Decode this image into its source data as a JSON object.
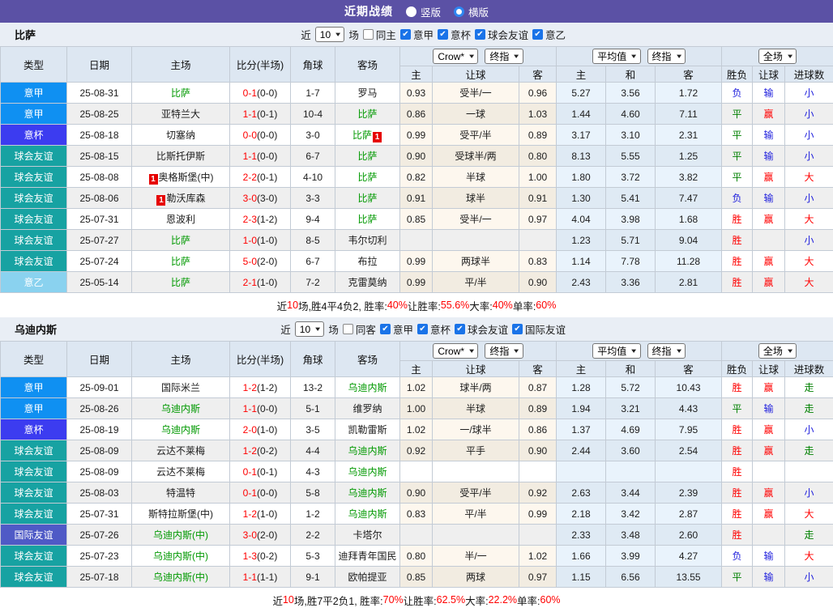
{
  "titlebar": {
    "title": "近期战绩",
    "radio_vertical": "竖版",
    "radio_horizontal": "横版",
    "selected": "横版"
  },
  "colors": {
    "titlebar_bg": "#5b51a5",
    "type_badges": {
      "意甲": "#0f90f2",
      "意杯": "#3c3cf0",
      "球会友谊": "#17a2a2",
      "意乙": "#8ad2ef",
      "国际友谊": "#4f5ac6"
    },
    "result_text": {
      "胜": "#ff0000",
      "平": "#008000",
      "负": "#2020dd",
      "赢": "#ff0000",
      "输": "#2020dd",
      "大": "#ff0000",
      "小": "#2020dd",
      "走": "#008000"
    },
    "team_highlight": "#009900",
    "score": "#ff0000"
  },
  "table_header": {
    "main_cols": [
      "类型",
      "日期",
      "主场",
      "比分(半场)",
      "角球",
      "客场"
    ],
    "odds_selects": [
      "Crow*",
      "终指"
    ],
    "odds_cols": [
      "主",
      "让球",
      "客"
    ],
    "avg_selects": [
      "平均值",
      "终指"
    ],
    "avg_cols": [
      "主",
      "和",
      "客"
    ],
    "result_selects": [
      "全场"
    ],
    "result_cols": [
      "胜负",
      "让球",
      "进球数"
    ]
  },
  "sections": [
    {
      "team": "比萨",
      "filter": {
        "prefix": "近",
        "matches": "10",
        "suffix": "场",
        "same_label": "同主",
        "same_checked": false,
        "leagues": [
          {
            "label": "意甲",
            "checked": true
          },
          {
            "label": "意杯",
            "checked": true
          },
          {
            "label": "球会友谊",
            "checked": true
          },
          {
            "label": "意乙",
            "checked": true
          }
        ]
      },
      "rows": [
        {
          "type": "意甲",
          "date": "25-08-31",
          "home": "比萨",
          "home_team": true,
          "home_card": "",
          "score": "0-1",
          "half": "0-0",
          "corner": "1-7",
          "away": "罗马",
          "away_team": false,
          "away_card": "",
          "odds": [
            "0.93",
            "受半/一",
            "0.96"
          ],
          "avg": [
            "5.27",
            "3.56",
            "1.72"
          ],
          "result": [
            "负",
            "输",
            "小"
          ]
        },
        {
          "type": "意甲",
          "date": "25-08-25",
          "home": "亚特兰大",
          "home_team": false,
          "home_card": "",
          "score": "1-1",
          "half": "0-1",
          "corner": "10-4",
          "away": "比萨",
          "away_team": true,
          "away_card": "",
          "odds": [
            "0.86",
            "一球",
            "1.03"
          ],
          "avg": [
            "1.44",
            "4.60",
            "7.11"
          ],
          "result": [
            "平",
            "赢",
            "小"
          ]
        },
        {
          "type": "意杯",
          "date": "25-08-18",
          "home": "切塞纳",
          "home_team": false,
          "home_card": "",
          "score": "0-0",
          "half": "0-0",
          "corner": "3-0",
          "away": "比萨",
          "away_team": true,
          "away_card": "1",
          "odds": [
            "0.99",
            "受平/半",
            "0.89"
          ],
          "avg": [
            "3.17",
            "3.10",
            "2.31"
          ],
          "result": [
            "平",
            "输",
            "小"
          ]
        },
        {
          "type": "球会友谊",
          "date": "25-08-15",
          "home": "比斯托伊斯",
          "home_team": false,
          "home_card": "",
          "score": "1-1",
          "half": "0-0",
          "corner": "6-7",
          "away": "比萨",
          "away_team": true,
          "away_card": "",
          "odds": [
            "0.90",
            "受球半/两",
            "0.80"
          ],
          "avg": [
            "8.13",
            "5.55",
            "1.25"
          ],
          "result": [
            "平",
            "输",
            "小"
          ]
        },
        {
          "type": "球会友谊",
          "date": "25-08-08",
          "home": "奥格斯堡(中)",
          "home_team": false,
          "home_card": "1",
          "score": "2-2",
          "half": "0-1",
          "corner": "4-10",
          "away": "比萨",
          "away_team": true,
          "away_card": "",
          "odds": [
            "0.82",
            "半球",
            "1.00"
          ],
          "avg": [
            "1.80",
            "3.72",
            "3.82"
          ],
          "result": [
            "平",
            "赢",
            "大"
          ]
        },
        {
          "type": "球会友谊",
          "date": "25-08-06",
          "home": "勒沃库森",
          "home_team": false,
          "home_card": "1",
          "score": "3-0",
          "half": "3-0",
          "corner": "3-3",
          "away": "比萨",
          "away_team": true,
          "away_card": "",
          "odds": [
            "0.91",
            "球半",
            "0.91"
          ],
          "avg": [
            "1.30",
            "5.41",
            "7.47"
          ],
          "result": [
            "负",
            "输",
            "小"
          ]
        },
        {
          "type": "球会友谊",
          "date": "25-07-31",
          "home": "恩波利",
          "home_team": false,
          "home_card": "",
          "score": "2-3",
          "half": "1-2",
          "corner": "9-4",
          "away": "比萨",
          "away_team": true,
          "away_card": "",
          "odds": [
            "0.85",
            "受半/一",
            "0.97"
          ],
          "avg": [
            "4.04",
            "3.98",
            "1.68"
          ],
          "result": [
            "胜",
            "赢",
            "大"
          ]
        },
        {
          "type": "球会友谊",
          "date": "25-07-27",
          "home": "比萨",
          "home_team": true,
          "home_card": "",
          "score": "1-0",
          "half": "1-0",
          "corner": "8-5",
          "away": "韦尔切利",
          "away_team": false,
          "away_card": "",
          "odds": [
            "",
            "",
            ""
          ],
          "avg": [
            "1.23",
            "5.71",
            "9.04"
          ],
          "result": [
            "胜",
            "",
            "小"
          ]
        },
        {
          "type": "球会友谊",
          "date": "25-07-24",
          "home": "比萨",
          "home_team": true,
          "home_card": "",
          "score": "5-0",
          "half": "2-0",
          "corner": "6-7",
          "away": "布拉",
          "away_team": false,
          "away_card": "",
          "odds": [
            "0.99",
            "两球半",
            "0.83"
          ],
          "avg": [
            "1.14",
            "7.78",
            "11.28"
          ],
          "result": [
            "胜",
            "赢",
            "大"
          ]
        },
        {
          "type": "意乙",
          "date": "25-05-14",
          "home": "比萨",
          "home_team": true,
          "home_card": "",
          "score": "2-1",
          "half": "1-0",
          "corner": "7-2",
          "away": "克雷莫纳",
          "away_team": false,
          "away_card": "",
          "odds": [
            "0.99",
            "平/半",
            "0.90"
          ],
          "avg": [
            "2.43",
            "3.36",
            "2.81"
          ],
          "result": [
            "胜",
            "赢",
            "大"
          ]
        }
      ],
      "summary_segments": [
        [
          "近",
          "k"
        ],
        [
          "10",
          "r"
        ],
        [
          "场,胜4平4负2, 胜率:",
          "k"
        ],
        [
          "40%",
          "r"
        ],
        [
          " 让胜率:",
          "k"
        ],
        [
          "55.6%",
          "r"
        ],
        [
          " 大率:",
          "k"
        ],
        [
          "40%",
          "r"
        ],
        [
          " 单率:",
          "k"
        ],
        [
          "60%",
          "r"
        ]
      ]
    },
    {
      "team": "乌迪内斯",
      "filter": {
        "prefix": "近",
        "matches": "10",
        "suffix": "场",
        "same_label": "同客",
        "same_checked": false,
        "leagues": [
          {
            "label": "意甲",
            "checked": true
          },
          {
            "label": "意杯",
            "checked": true
          },
          {
            "label": "球会友谊",
            "checked": true
          },
          {
            "label": "国际友谊",
            "checked": true
          }
        ]
      },
      "rows": [
        {
          "type": "意甲",
          "date": "25-09-01",
          "home": "国际米兰",
          "home_team": false,
          "home_card": "",
          "score": "1-2",
          "half": "1-2",
          "corner": "13-2",
          "away": "乌迪内斯",
          "away_team": true,
          "away_card": "",
          "odds": [
            "1.02",
            "球半/两",
            "0.87"
          ],
          "avg": [
            "1.28",
            "5.72",
            "10.43"
          ],
          "result": [
            "胜",
            "赢",
            "走"
          ]
        },
        {
          "type": "意甲",
          "date": "25-08-26",
          "home": "乌迪内斯",
          "home_team": true,
          "home_card": "",
          "score": "1-1",
          "half": "0-0",
          "corner": "5-1",
          "away": "维罗纳",
          "away_team": false,
          "away_card": "",
          "odds": [
            "1.00",
            "半球",
            "0.89"
          ],
          "avg": [
            "1.94",
            "3.21",
            "4.43"
          ],
          "result": [
            "平",
            "输",
            "走"
          ]
        },
        {
          "type": "意杯",
          "date": "25-08-19",
          "home": "乌迪内斯",
          "home_team": true,
          "home_card": "",
          "score": "2-0",
          "half": "1-0",
          "corner": "3-5",
          "away": "凯勒雷斯",
          "away_team": false,
          "away_card": "",
          "odds": [
            "1.02",
            "一/球半",
            "0.86"
          ],
          "avg": [
            "1.37",
            "4.69",
            "7.95"
          ],
          "result": [
            "胜",
            "赢",
            "小"
          ]
        },
        {
          "type": "球会友谊",
          "date": "25-08-09",
          "home": "云达不莱梅",
          "home_team": false,
          "home_card": "",
          "score": "1-2",
          "half": "0-2",
          "corner": "4-4",
          "away": "乌迪内斯",
          "away_team": true,
          "away_card": "",
          "odds": [
            "0.92",
            "平手",
            "0.90"
          ],
          "avg": [
            "2.44",
            "3.60",
            "2.54"
          ],
          "result": [
            "胜",
            "赢",
            "走"
          ]
        },
        {
          "type": "球会友谊",
          "date": "25-08-09",
          "home": "云达不莱梅",
          "home_team": false,
          "home_card": "",
          "score": "0-1",
          "half": "0-1",
          "corner": "4-3",
          "away": "乌迪内斯",
          "away_team": true,
          "away_card": "",
          "odds": [
            "",
            "",
            ""
          ],
          "avg": [
            "",
            "",
            ""
          ],
          "result": [
            "胜",
            "",
            ""
          ]
        },
        {
          "type": "球会友谊",
          "date": "25-08-03",
          "home": "特温特",
          "home_team": false,
          "home_card": "",
          "score": "0-1",
          "half": "0-0",
          "corner": "5-8",
          "away": "乌迪内斯",
          "away_team": true,
          "away_card": "",
          "odds": [
            "0.90",
            "受平/半",
            "0.92"
          ],
          "avg": [
            "2.63",
            "3.44",
            "2.39"
          ],
          "result": [
            "胜",
            "赢",
            "小"
          ]
        },
        {
          "type": "球会友谊",
          "date": "25-07-31",
          "home": "斯特拉斯堡(中)",
          "home_team": false,
          "home_card": "",
          "score": "1-2",
          "half": "1-0",
          "corner": "1-2",
          "away": "乌迪内斯",
          "away_team": true,
          "away_card": "",
          "odds": [
            "0.83",
            "平/半",
            "0.99"
          ],
          "avg": [
            "2.18",
            "3.42",
            "2.87"
          ],
          "result": [
            "胜",
            "赢",
            "大"
          ]
        },
        {
          "type": "国际友谊",
          "date": "25-07-26",
          "home": "乌迪内斯(中)",
          "home_team": true,
          "home_card": "",
          "score": "3-0",
          "half": "2-0",
          "corner": "2-2",
          "away": "卡塔尔",
          "away_team": false,
          "away_card": "",
          "odds": [
            "",
            "",
            ""
          ],
          "avg": [
            "2.33",
            "3.48",
            "2.60"
          ],
          "result": [
            "胜",
            "",
            "走"
          ]
        },
        {
          "type": "球会友谊",
          "date": "25-07-23",
          "home": "乌迪内斯(中)",
          "home_team": true,
          "home_card": "",
          "score": "1-3",
          "half": "0-2",
          "corner": "5-3",
          "away": "迪拜青年国民",
          "away_team": false,
          "away_card": "",
          "odds": [
            "0.80",
            "半/一",
            "1.02"
          ],
          "avg": [
            "1.66",
            "3.99",
            "4.27"
          ],
          "result": [
            "负",
            "输",
            "大"
          ]
        },
        {
          "type": "球会友谊",
          "date": "25-07-18",
          "home": "乌迪内斯(中)",
          "home_team": true,
          "home_card": "",
          "score": "1-1",
          "half": "1-1",
          "corner": "9-1",
          "away": "欧帕提亚",
          "away_team": false,
          "away_card": "",
          "odds": [
            "0.85",
            "两球",
            "0.97"
          ],
          "avg": [
            "1.15",
            "6.56",
            "13.55"
          ],
          "result": [
            "平",
            "输",
            "小"
          ]
        }
      ],
      "summary_segments": [
        [
          "近",
          "k"
        ],
        [
          "10",
          "r"
        ],
        [
          "场,胜7平2负1, 胜率:",
          "k"
        ],
        [
          "70%",
          "r"
        ],
        [
          " 让胜率:",
          "k"
        ],
        [
          "62.5%",
          "r"
        ],
        [
          " 大率:",
          "k"
        ],
        [
          "22.2%",
          "r"
        ],
        [
          " 单率:",
          "k"
        ],
        [
          "60%",
          "r"
        ]
      ]
    }
  ]
}
